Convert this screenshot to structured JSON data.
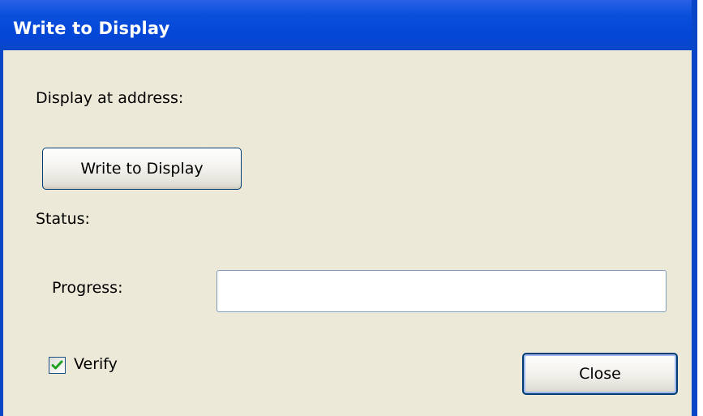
{
  "window": {
    "title": "Write to Display"
  },
  "dialog": {
    "address_label": "Display at address:",
    "write_button_label": "Write to Display",
    "status_label": "Status:",
    "progress_label": "Progress:",
    "progress_value": 0,
    "verify_label": "Verify",
    "verify_checked": true,
    "close_button_label": "Close"
  },
  "colors": {
    "titlebar": "#0a4fdc",
    "dialog_background": "#ece9d8",
    "checkmark": "#21a121",
    "button_border": "#003c74"
  }
}
